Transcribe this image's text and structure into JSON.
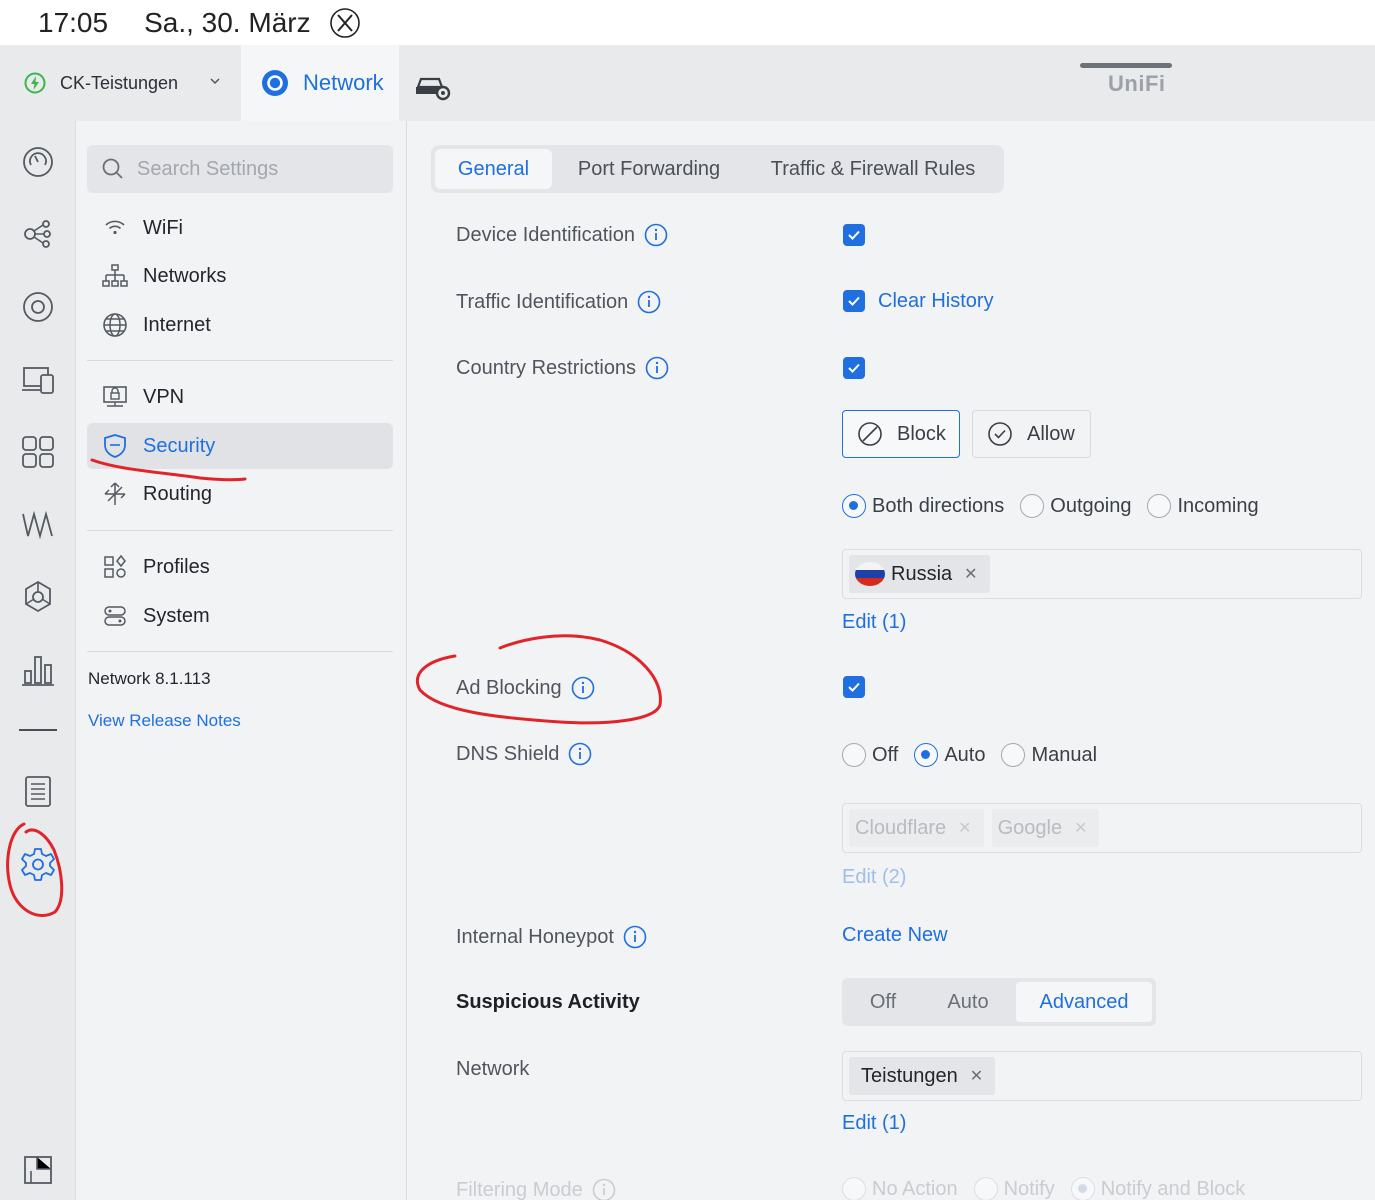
{
  "status_bar": {
    "time": "17:05",
    "date": "Sa., 30. März"
  },
  "header": {
    "site_name": "CK-Teistungen",
    "app_tab": "Network",
    "logo_text": "UniFi"
  },
  "settings_nav": {
    "search_placeholder": "Search Settings",
    "items": [
      {
        "label": "WiFi",
        "icon": "wifi-icon"
      },
      {
        "label": "Networks",
        "icon": "networks-icon"
      },
      {
        "label": "Internet",
        "icon": "globe-icon"
      },
      {
        "label": "VPN",
        "icon": "vpn-icon"
      },
      {
        "label": "Security",
        "icon": "shield-icon",
        "active": true
      },
      {
        "label": "Routing",
        "icon": "routing-icon"
      },
      {
        "label": "Profiles",
        "icon": "profiles-icon"
      },
      {
        "label": "System",
        "icon": "system-icon"
      }
    ],
    "version": "Network 8.1.113",
    "release_notes": "View Release Notes"
  },
  "tabs": [
    "General",
    "Port Forwarding",
    "Traffic & Firewall Rules"
  ],
  "settings": {
    "device_identification": {
      "label": "Device Identification",
      "checked": true
    },
    "traffic_identification": {
      "label": "Traffic Identification",
      "checked": true,
      "action": "Clear History"
    },
    "country_restrictions": {
      "label": "Country Restrictions",
      "checked": true,
      "modes": [
        "Block",
        "Allow"
      ],
      "selected_mode": "Block",
      "directions": [
        "Both directions",
        "Outgoing",
        "Incoming"
      ],
      "selected_direction": "Both directions",
      "countries": [
        "Russia"
      ],
      "edit": "Edit (1)"
    },
    "ad_blocking": {
      "label": "Ad Blocking",
      "checked": true
    },
    "dns_shield": {
      "label": "DNS Shield",
      "options": [
        "Off",
        "Auto",
        "Manual"
      ],
      "selected": "Auto",
      "servers": [
        "Cloudflare",
        "Google"
      ],
      "edit": "Edit (2)"
    },
    "internal_honeypot": {
      "label": "Internal Honeypot",
      "action": "Create New"
    },
    "suspicious_activity": {
      "label": "Suspicious Activity",
      "options": [
        "Off",
        "Auto",
        "Advanced"
      ],
      "selected": "Advanced"
    },
    "network": {
      "label": "Network",
      "networks": [
        "Teistungen"
      ],
      "edit": "Edit (1)"
    },
    "filtering_mode": {
      "label": "Filtering Mode",
      "options": [
        "No Action",
        "Notify",
        "Notify and Block"
      ],
      "selected": "Notify and Block"
    }
  },
  "colors": {
    "accent": "#1f6fe0",
    "annotation": "#e0242a",
    "site_status": "#3bb64a"
  }
}
